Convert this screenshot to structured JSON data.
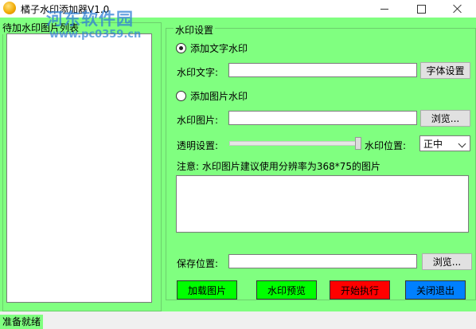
{
  "window": {
    "title": "橘子水印添加器V1.0"
  },
  "watermark": {
    "site_name": "河东软件园",
    "url": "www.pc0359.cn"
  },
  "list_panel": {
    "legend": "待加水印图片列表"
  },
  "settings": {
    "legend": "水印设置",
    "text_mode": {
      "label": "添加文字水印",
      "checked": true
    },
    "text_label": "水印文字:",
    "text_value": "",
    "font_button": "字体设置",
    "image_mode": {
      "label": "添加图片水印",
      "checked": false
    },
    "image_label": "水印图片:",
    "image_value": "",
    "browse_image_button": "浏览...",
    "opacity_label": "透明设置:",
    "opacity_level": 1.0,
    "position_label": "水印位置:",
    "position_value": "正中",
    "note": "注意: 水印图片建议使用分辨率为368*75的图片",
    "save_label": "保存位置:",
    "save_value": "",
    "browse_save_button": "浏览..."
  },
  "actions": {
    "load": {
      "label": "加载图片",
      "color": "#00ff00"
    },
    "preview": {
      "label": "水印预览",
      "color": "#00ff00"
    },
    "start": {
      "label": "开始执行",
      "color": "#ff0000"
    },
    "exit": {
      "label": "关闭退出",
      "color": "#0080ff"
    }
  },
  "status": {
    "text": "准备就绪"
  },
  "colors": {
    "background": "#80ff80"
  }
}
